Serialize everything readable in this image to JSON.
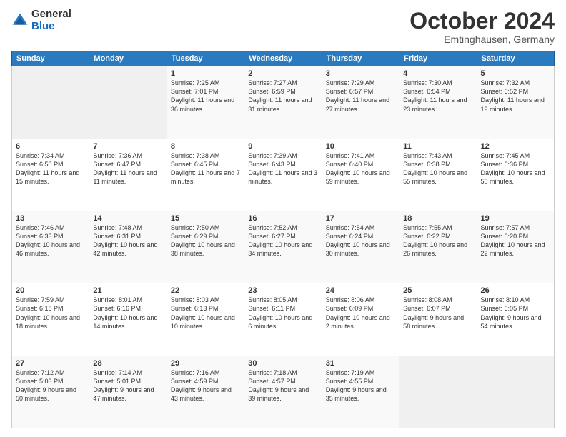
{
  "header": {
    "title": "October 2024",
    "location": "Emtinghausen, Germany"
  },
  "days_of_week": [
    "Sunday",
    "Monday",
    "Tuesday",
    "Wednesday",
    "Thursday",
    "Friday",
    "Saturday"
  ],
  "weeks": [
    [
      {
        "day": "",
        "sunrise": "",
        "sunset": "",
        "daylight": "",
        "empty": true
      },
      {
        "day": "",
        "sunrise": "",
        "sunset": "",
        "daylight": "",
        "empty": true
      },
      {
        "day": "1",
        "sunrise": "Sunrise: 7:25 AM",
        "sunset": "Sunset: 7:01 PM",
        "daylight": "Daylight: 11 hours and 36 minutes."
      },
      {
        "day": "2",
        "sunrise": "Sunrise: 7:27 AM",
        "sunset": "Sunset: 6:59 PM",
        "daylight": "Daylight: 11 hours and 31 minutes."
      },
      {
        "day": "3",
        "sunrise": "Sunrise: 7:29 AM",
        "sunset": "Sunset: 6:57 PM",
        "daylight": "Daylight: 11 hours and 27 minutes."
      },
      {
        "day": "4",
        "sunrise": "Sunrise: 7:30 AM",
        "sunset": "Sunset: 6:54 PM",
        "daylight": "Daylight: 11 hours and 23 minutes."
      },
      {
        "day": "5",
        "sunrise": "Sunrise: 7:32 AM",
        "sunset": "Sunset: 6:52 PM",
        "daylight": "Daylight: 11 hours and 19 minutes."
      }
    ],
    [
      {
        "day": "6",
        "sunrise": "Sunrise: 7:34 AM",
        "sunset": "Sunset: 6:50 PM",
        "daylight": "Daylight: 11 hours and 15 minutes."
      },
      {
        "day": "7",
        "sunrise": "Sunrise: 7:36 AM",
        "sunset": "Sunset: 6:47 PM",
        "daylight": "Daylight: 11 hours and 11 minutes."
      },
      {
        "day": "8",
        "sunrise": "Sunrise: 7:38 AM",
        "sunset": "Sunset: 6:45 PM",
        "daylight": "Daylight: 11 hours and 7 minutes."
      },
      {
        "day": "9",
        "sunrise": "Sunrise: 7:39 AM",
        "sunset": "Sunset: 6:43 PM",
        "daylight": "Daylight: 11 hours and 3 minutes."
      },
      {
        "day": "10",
        "sunrise": "Sunrise: 7:41 AM",
        "sunset": "Sunset: 6:40 PM",
        "daylight": "Daylight: 10 hours and 59 minutes."
      },
      {
        "day": "11",
        "sunrise": "Sunrise: 7:43 AM",
        "sunset": "Sunset: 6:38 PM",
        "daylight": "Daylight: 10 hours and 55 minutes."
      },
      {
        "day": "12",
        "sunrise": "Sunrise: 7:45 AM",
        "sunset": "Sunset: 6:36 PM",
        "daylight": "Daylight: 10 hours and 50 minutes."
      }
    ],
    [
      {
        "day": "13",
        "sunrise": "Sunrise: 7:46 AM",
        "sunset": "Sunset: 6:33 PM",
        "daylight": "Daylight: 10 hours and 46 minutes."
      },
      {
        "day": "14",
        "sunrise": "Sunrise: 7:48 AM",
        "sunset": "Sunset: 6:31 PM",
        "daylight": "Daylight: 10 hours and 42 minutes."
      },
      {
        "day": "15",
        "sunrise": "Sunrise: 7:50 AM",
        "sunset": "Sunset: 6:29 PM",
        "daylight": "Daylight: 10 hours and 38 minutes."
      },
      {
        "day": "16",
        "sunrise": "Sunrise: 7:52 AM",
        "sunset": "Sunset: 6:27 PM",
        "daylight": "Daylight: 10 hours and 34 minutes."
      },
      {
        "day": "17",
        "sunrise": "Sunrise: 7:54 AM",
        "sunset": "Sunset: 6:24 PM",
        "daylight": "Daylight: 10 hours and 30 minutes."
      },
      {
        "day": "18",
        "sunrise": "Sunrise: 7:55 AM",
        "sunset": "Sunset: 6:22 PM",
        "daylight": "Daylight: 10 hours and 26 minutes."
      },
      {
        "day": "19",
        "sunrise": "Sunrise: 7:57 AM",
        "sunset": "Sunset: 6:20 PM",
        "daylight": "Daylight: 10 hours and 22 minutes."
      }
    ],
    [
      {
        "day": "20",
        "sunrise": "Sunrise: 7:59 AM",
        "sunset": "Sunset: 6:18 PM",
        "daylight": "Daylight: 10 hours and 18 minutes."
      },
      {
        "day": "21",
        "sunrise": "Sunrise: 8:01 AM",
        "sunset": "Sunset: 6:16 PM",
        "daylight": "Daylight: 10 hours and 14 minutes."
      },
      {
        "day": "22",
        "sunrise": "Sunrise: 8:03 AM",
        "sunset": "Sunset: 6:13 PM",
        "daylight": "Daylight: 10 hours and 10 minutes."
      },
      {
        "day": "23",
        "sunrise": "Sunrise: 8:05 AM",
        "sunset": "Sunset: 6:11 PM",
        "daylight": "Daylight: 10 hours and 6 minutes."
      },
      {
        "day": "24",
        "sunrise": "Sunrise: 8:06 AM",
        "sunset": "Sunset: 6:09 PM",
        "daylight": "Daylight: 10 hours and 2 minutes."
      },
      {
        "day": "25",
        "sunrise": "Sunrise: 8:08 AM",
        "sunset": "Sunset: 6:07 PM",
        "daylight": "Daylight: 9 hours and 58 minutes."
      },
      {
        "day": "26",
        "sunrise": "Sunrise: 8:10 AM",
        "sunset": "Sunset: 6:05 PM",
        "daylight": "Daylight: 9 hours and 54 minutes."
      }
    ],
    [
      {
        "day": "27",
        "sunrise": "Sunrise: 7:12 AM",
        "sunset": "Sunset: 5:03 PM",
        "daylight": "Daylight: 9 hours and 50 minutes."
      },
      {
        "day": "28",
        "sunrise": "Sunrise: 7:14 AM",
        "sunset": "Sunset: 5:01 PM",
        "daylight": "Daylight: 9 hours and 47 minutes."
      },
      {
        "day": "29",
        "sunrise": "Sunrise: 7:16 AM",
        "sunset": "Sunset: 4:59 PM",
        "daylight": "Daylight: 9 hours and 43 minutes."
      },
      {
        "day": "30",
        "sunrise": "Sunrise: 7:18 AM",
        "sunset": "Sunset: 4:57 PM",
        "daylight": "Daylight: 9 hours and 39 minutes."
      },
      {
        "day": "31",
        "sunrise": "Sunrise: 7:19 AM",
        "sunset": "Sunset: 4:55 PM",
        "daylight": "Daylight: 9 hours and 35 minutes."
      },
      {
        "day": "",
        "sunrise": "",
        "sunset": "",
        "daylight": "",
        "empty": true
      },
      {
        "day": "",
        "sunrise": "",
        "sunset": "",
        "daylight": "",
        "empty": true
      }
    ]
  ]
}
